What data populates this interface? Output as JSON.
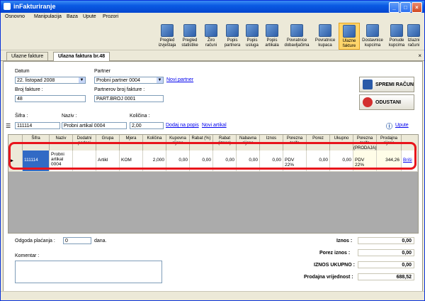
{
  "window": {
    "title": "inFakturiranje"
  },
  "menu": [
    "Osnovno",
    "Manipulacija",
    "Baza",
    "Upute",
    "Prozori"
  ],
  "toolbar": [
    {
      "l1": "Pregled",
      "l2": "izvještaja"
    },
    {
      "l1": "Pregled",
      "l2": "statistike"
    },
    {
      "l1": "Žiro",
      "l2": "računi"
    },
    {
      "l1": "Popis",
      "l2": "partnera"
    },
    {
      "l1": "Popis",
      "l2": "usluga"
    },
    {
      "l1": "Popis",
      "l2": "artikala"
    },
    {
      "l1": "Povratnice",
      "l2": "dobavljačima"
    },
    {
      "l1": "Povratnice",
      "l2": "kupaca"
    },
    {
      "l1": "Ulazne",
      "l2": "fakture"
    },
    {
      "l1": "Dostavnice",
      "l2": "kupcima"
    },
    {
      "l1": "Ponude",
      "l2": "kupcima"
    },
    {
      "l1": "Izlazni",
      "l2": "računi"
    }
  ],
  "tabs": [
    "Ulazne fakture",
    "Ulazna faktura br.48"
  ],
  "form": {
    "datum_label": "Datum",
    "datum_value": "22. listopad 2008",
    "partner_label": "Partner",
    "partner_value": "Probni partner 0004",
    "novi_partner": "Novi partner",
    "broj_label": "Broj fakture :",
    "broj_value": "48",
    "pbroj_label": "Partnerov broj fakture :",
    "pbroj_value": "PART.BROJ 0001",
    "sifra_label": "Šifra :",
    "sifra_value": "111114",
    "naziv_label": "Naziv :",
    "naziv_value": "Probni artikal 0004",
    "kolicina_label": "Količina :",
    "kolicina_value": "2,00",
    "dodaj_link": "Dodaj na popis",
    "novi_artikal": "Novi artikal",
    "upute": "Upute"
  },
  "buttons": {
    "save": "SPREMI RAČUN",
    "cancel": "ODUSTANI"
  },
  "grid": {
    "headers": [
      "Šifra",
      "Naziv",
      "Dodatni podaci",
      "Grupa",
      "Mjera",
      "Količina",
      "Kupovna cijena",
      "Rabat (%)",
      "Rabat (iznos)",
      "Nabavna cijena",
      "Iznos",
      "Porezna tarifa",
      "Porez",
      "Ukupno",
      "Porezna tarifa (PRODAJA)",
      "Prodajna cijena"
    ],
    "row": {
      "sifra": "111114",
      "naziv": "Probni artikal 0004",
      "dodatni": "",
      "grupa": "Artikl",
      "mjera": "KOM",
      "kolicina": "2,000",
      "kupovna": "0,00",
      "rabat_pct": "0,00",
      "rabat_iznos": "0,00",
      "nabavna": "0,00",
      "iznos": "0,00",
      "porezna": "PDV 22%",
      "porez": "0,00",
      "ukupno": "0,00",
      "porezna_prod": "PDV 22%",
      "prodajna": "344,26",
      "delete": "Briši"
    }
  },
  "odgoda": {
    "label": "Odgoda plaćanja :",
    "value": "0",
    "unit": "dana."
  },
  "komentar_label": "Komentar :",
  "summary": {
    "iznos_label": "Iznos :",
    "iznos": "0,00",
    "porez_label": "Porez iznos :",
    "porez": "0,00",
    "ukupno_label": "IZNOS UKUPNO :",
    "ukupno": "0,00",
    "prodajna_label": "Prodajna vrijednost :",
    "prodajna": "688,52"
  }
}
